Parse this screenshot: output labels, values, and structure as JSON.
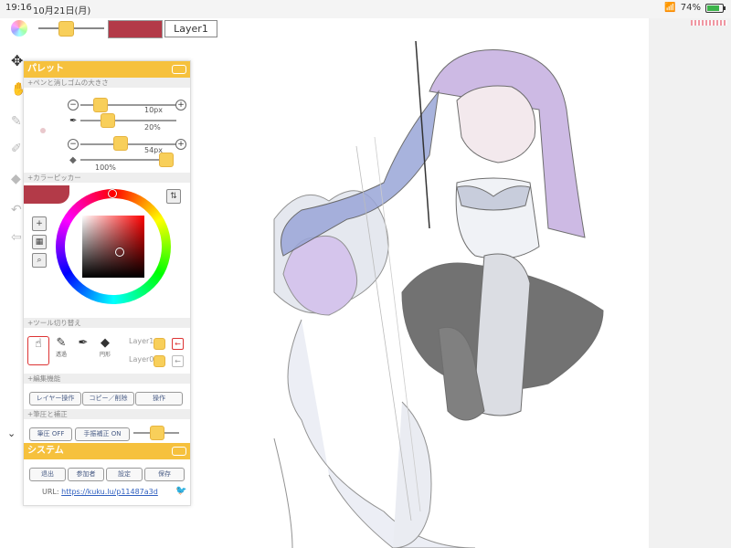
{
  "statusbar": {
    "time": "19:16",
    "date": "10月21日(月)",
    "battery": "74%",
    "battery_level": 0.74
  },
  "toolbar": {
    "layer_name": "Layer1",
    "current_color": "#b33a48"
  },
  "palette": {
    "title": "パレット",
    "pen_section": "+ペンと消しゴムの大きさ",
    "pen_size": "10px",
    "pen_opacity": "20%",
    "eraser_size": "54px",
    "eraser_opacity": "100%",
    "color_section": "+カラーピッカー",
    "tool_section": "+ツール切り替え",
    "tools": [
      {
        "icon": "hand-icon",
        "label": ""
      },
      {
        "icon": "pen-icon",
        "label": "透過"
      },
      {
        "icon": "dropper-icon",
        "label": ""
      },
      {
        "icon": "eraser-icon",
        "label": "円形"
      }
    ],
    "layer_rows": [
      "Layer1",
      "Layer0"
    ],
    "edit_section": "+編集機能",
    "edit_buttons": [
      "レイヤー操作",
      "コピー／削除",
      "操作"
    ],
    "pressure_section": "+筆圧と補正",
    "pressure_button": "筆圧 OFF",
    "correction_button": "手振補正 ON"
  },
  "system": {
    "title": "システム",
    "buttons": [
      "退出",
      "参加者",
      "設定",
      "保存"
    ],
    "url_label": "URL:",
    "url": "https://kuku.lu/p11487a3d"
  }
}
